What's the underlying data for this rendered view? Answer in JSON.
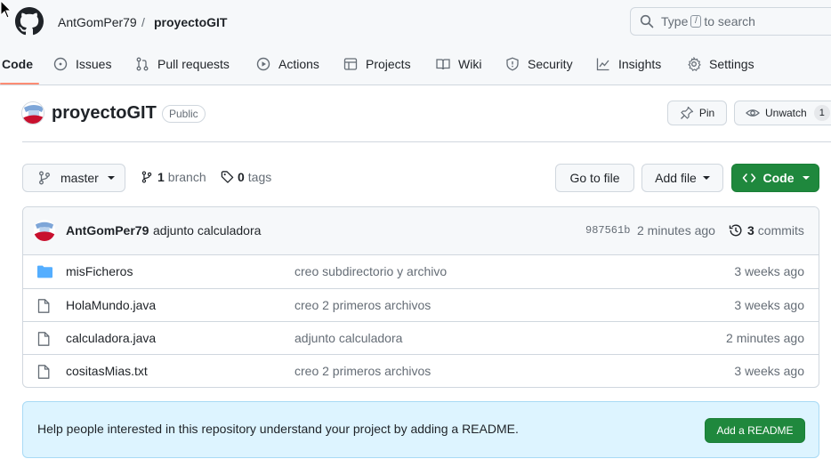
{
  "header": {
    "owner": "AntGomPer79",
    "separator": "/",
    "repo": "proyectoGIT",
    "search": {
      "prefix": "Type",
      "key": "/",
      "suffix": "to search"
    }
  },
  "nav": {
    "tabs": [
      {
        "label": "Code",
        "icon": "code-icon",
        "active": true
      },
      {
        "label": "Issues",
        "icon": "issue-icon"
      },
      {
        "label": "Pull requests",
        "icon": "pull-request-icon"
      },
      {
        "label": "Actions",
        "icon": "play-icon"
      },
      {
        "label": "Projects",
        "icon": "table-icon"
      },
      {
        "label": "Wiki",
        "icon": "book-icon"
      },
      {
        "label": "Security",
        "icon": "shield-icon"
      },
      {
        "label": "Insights",
        "icon": "graph-icon"
      },
      {
        "label": "Settings",
        "icon": "gear-icon"
      }
    ]
  },
  "repo": {
    "title": "proyectoGIT",
    "visibility": "Public",
    "pin_label": "Pin",
    "watch_label": "Unwatch",
    "watch_count": "1"
  },
  "toolbar": {
    "branch": "master",
    "branch_count": "1",
    "branch_label": "branch",
    "tag_count": "0",
    "tag_label": "tags",
    "go_to_file": "Go to file",
    "add_file": "Add file",
    "code": "Code"
  },
  "commit": {
    "author": "AntGomPer79",
    "message": "adjunto calculadora",
    "sha": "987561b",
    "time": "2 minutes ago",
    "count": "3",
    "count_label": "commits"
  },
  "files": [
    {
      "type": "folder",
      "name": "misFicheros",
      "message": "creo subdirectorio y archivo",
      "age": "3 weeks ago"
    },
    {
      "type": "file",
      "name": "HolaMundo.java",
      "message": "creo 2 primeros archivos",
      "age": "3 weeks ago"
    },
    {
      "type": "file",
      "name": "calculadora.java",
      "message": "adjunto calculadora",
      "age": "2 minutes ago"
    },
    {
      "type": "file",
      "name": "cositasMias.txt",
      "message": "creo 2 primeros archivos",
      "age": "3 weeks ago"
    }
  ],
  "readme": {
    "text": "Help people interested in this repository understand your project by adding a README.",
    "button": "Add a README"
  },
  "colors": {
    "accent_green": "#1f883d",
    "active_tab_underline": "#fd8c73",
    "folder_blue": "#54aeff",
    "banner_bg": "#ddf4ff"
  }
}
